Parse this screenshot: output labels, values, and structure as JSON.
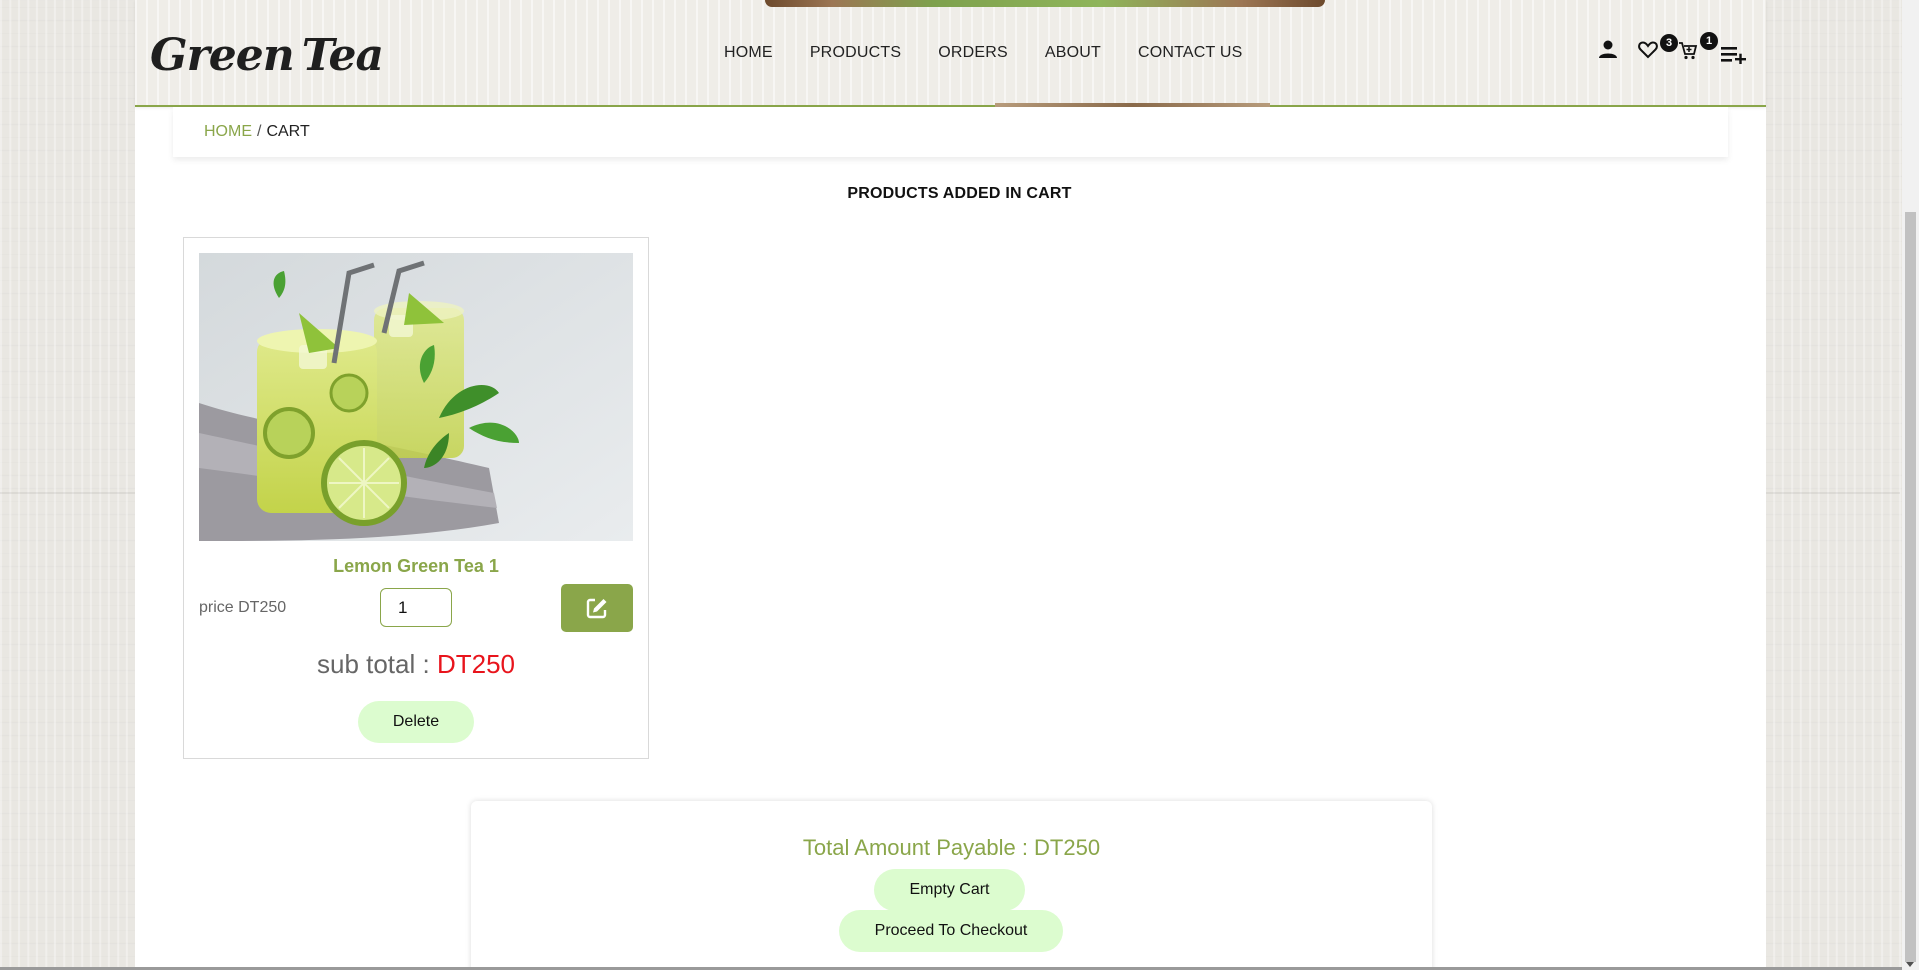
{
  "logo": {
    "left_word": "Green",
    "right_word": "Tea"
  },
  "nav": {
    "items": [
      {
        "label": "HOME"
      },
      {
        "label": "PRODUCTS"
      },
      {
        "label": "ORDERS"
      },
      {
        "label": "ABOUT"
      },
      {
        "label": "CONTACT US"
      }
    ]
  },
  "header_icons": {
    "user": "user-icon",
    "wishlist": "heart-icon",
    "wishlist_count": "3",
    "cart": "cart-icon",
    "cart_count": "1",
    "menu": "menu-add-icon"
  },
  "breadcrumb": {
    "home": "HOME",
    "separator": "/",
    "current": "CART"
  },
  "section_title": "PRODUCTS ADDED IN CART",
  "cart_items": [
    {
      "image": "lemon-green-tea-image",
      "name": "Lemon Green Tea 1",
      "price_label": "price DT250",
      "quantity": "1",
      "subtotal_label": "sub total :",
      "subtotal_value": "DT250",
      "delete_label": "Delete"
    }
  ],
  "totals": {
    "total_label": "Total Amount Payable : DT250",
    "empty_label": "Empty Cart",
    "checkout_label": "Proceed To Checkout"
  },
  "colors": {
    "accent": "#8aa64a",
    "subtotal_red": "#e8141c",
    "pill_bg": "#dcfccf"
  }
}
